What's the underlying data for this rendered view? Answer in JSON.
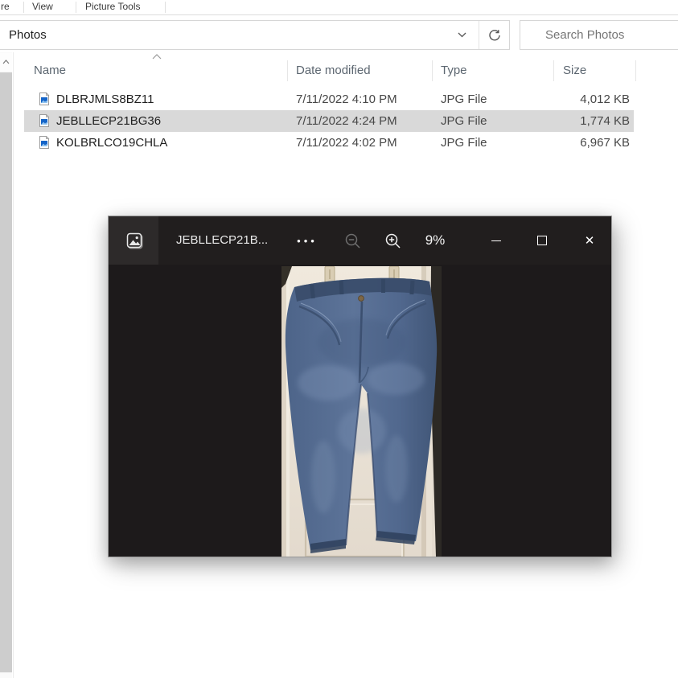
{
  "ribbon": {
    "tabs": [
      {
        "label": "re"
      },
      {
        "label": "View"
      },
      {
        "label": "Picture Tools"
      }
    ]
  },
  "address_bar": {
    "value": "Photos",
    "dropdown_icon": "chevron-down-icon",
    "refresh_icon": "refresh-icon"
  },
  "search": {
    "placeholder": "Search Photos",
    "icon": "search-icon"
  },
  "file_list": {
    "columns": [
      {
        "label": "Name"
      },
      {
        "label": "Date modified"
      },
      {
        "label": "Type"
      },
      {
        "label": "Size"
      }
    ],
    "sort": {
      "column": "Name",
      "direction": "ascending"
    },
    "rows": [
      {
        "name": "DLBRJMLS8BZ11",
        "date_modified": "7/11/2022 4:10 PM",
        "type": "JPG File",
        "size": "4,012 KB",
        "selected": false
      },
      {
        "name": "JEBLLECP21BG36",
        "date_modified": "7/11/2022 4:24 PM",
        "type": "JPG File",
        "size": "1,774 KB",
        "selected": true
      },
      {
        "name": "KOLBRLCO19CHLA",
        "date_modified": "7/11/2022 4:02 PM",
        "type": "JPG File",
        "size": "6,967 KB",
        "selected": false
      }
    ]
  },
  "photo_viewer": {
    "app_icon": "photos-app-icon",
    "title": "JEBLLECP21B...",
    "see_more_label": "•••",
    "zoom_out_icon": "zoom-out-icon",
    "zoom_in_icon": "zoom-in-icon",
    "zoom_level": "9%",
    "window_controls": {
      "minimize": "minimize",
      "maximize": "maximize",
      "close": "✕"
    },
    "image_alt": "Photo of blue denim jeans hanging from two clips against a white paneled door"
  },
  "colors": {
    "selection_bg": "#d9d9d9",
    "viewer_titlebar": "#211e1e",
    "viewer_canvas": "#1d1a1b",
    "viewer_icon_tile": "#2d2a2a",
    "denim": "#54719a",
    "door": "#e9e1d5",
    "header_text": "#5c6670"
  }
}
